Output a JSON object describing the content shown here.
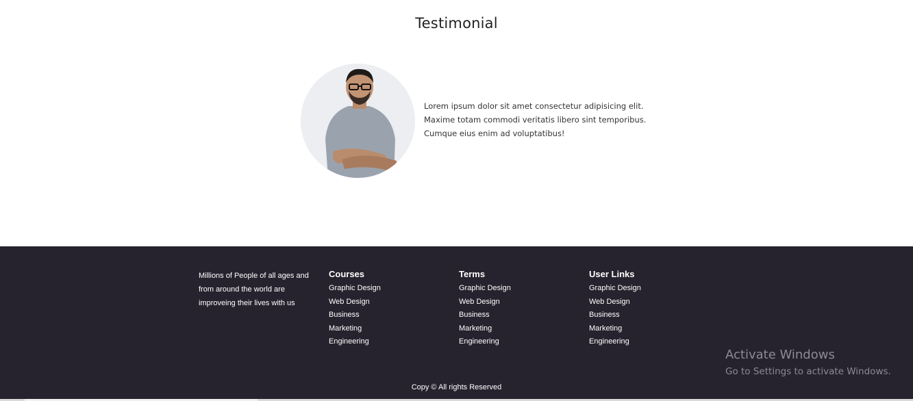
{
  "testimonial": {
    "title": "Testimonial",
    "quote_lines": [
      "Lorem ipsum dolor sit amet consectetur adipisicing elit.",
      "Maxime totam commodi veritatis libero sint temporibus.",
      "Cumque eius enim ad voluptatibus!"
    ]
  },
  "footer": {
    "about_lines": [
      "Millions of People of all ages and",
      "from around the world are",
      "improveing their lives with us"
    ],
    "columns": [
      {
        "heading": "Courses",
        "links": [
          "Graphic Design",
          "Web Design",
          "Business",
          "Marketing",
          "Engineering"
        ]
      },
      {
        "heading": "Terms",
        "links": [
          "Graphic Design",
          "Web Design",
          "Business",
          "Marketing",
          "Engineering"
        ]
      },
      {
        "heading": "User Links",
        "links": [
          "Graphic Design",
          "Web Design",
          "Business",
          "Marketing",
          "Engineering"
        ]
      }
    ],
    "copyright": "Copy © All rights Reserved"
  },
  "watermark": {
    "title": "Activate Windows",
    "subtitle": "Go to Settings to activate Windows."
  },
  "colors": {
    "footer_bg": "#26232e",
    "text_dark": "#222222",
    "watermark": "#8d8a95"
  }
}
